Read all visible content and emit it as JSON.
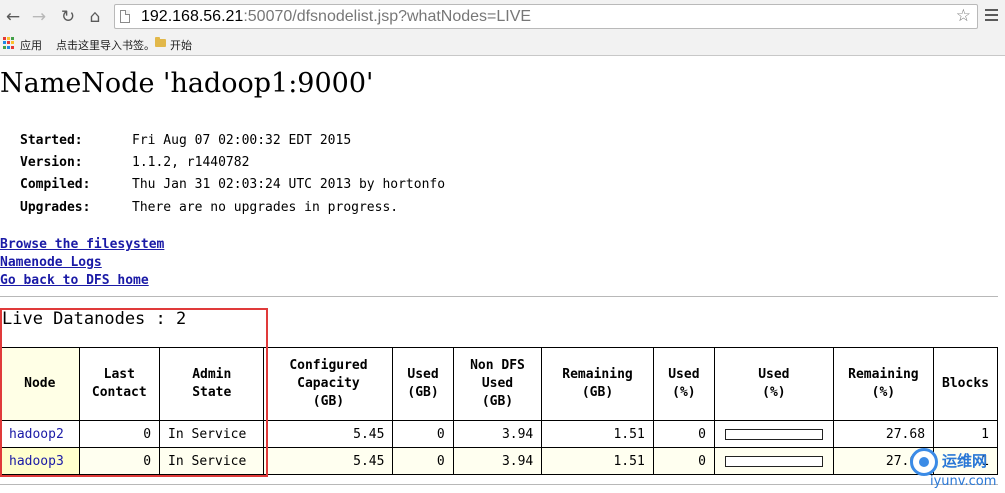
{
  "browser": {
    "url_host": "192.168.56.21",
    "url_rest": ":50070/dfsnodelist.jsp?whatNodes=LIVE",
    "bookmarks": [
      "应用",
      "点击这里导入书签。",
      "开始"
    ]
  },
  "page": {
    "title": "NameNode 'hadoop1:9000'",
    "info": [
      {
        "key": "Started:",
        "value": "Fri Aug 07 02:00:32 EDT 2015"
      },
      {
        "key": "Version:",
        "value": "1.1.2, r1440782"
      },
      {
        "key": "Compiled:",
        "value": "Thu Jan 31 02:03:24 UTC 2013 by hortonfo"
      },
      {
        "key": "Upgrades:",
        "value": "There are no upgrades in progress."
      }
    ],
    "links": [
      "Browse the filesystem",
      "Namenode Logs",
      "Go back to DFS home"
    ],
    "live_title": "Live Datanodes : 2"
  },
  "table": {
    "headers": [
      {
        "l1": "Node",
        "l2": "",
        "l3": ""
      },
      {
        "l1": "Last",
        "l2": "Contact",
        "l3": ""
      },
      {
        "l1": "Admin",
        "l2": "State",
        "l3": ""
      },
      {
        "l1": "Configured",
        "l2": "Capacity",
        "l3": "(GB)"
      },
      {
        "l1": "Used",
        "l2": "(GB)",
        "l3": ""
      },
      {
        "l1": "Non DFS",
        "l2": "Used",
        "l3": "(GB)"
      },
      {
        "l1": "Remaining",
        "l2": "(GB)",
        "l3": ""
      },
      {
        "l1": "Used",
        "l2": "(%)",
        "l3": ""
      },
      {
        "l1": "Used",
        "l2": "(%)",
        "l3": ""
      },
      {
        "l1": "Remaining",
        "l2": "(%)",
        "l3": ""
      },
      {
        "l1": "Blocks",
        "l2": "",
        "l3": ""
      }
    ],
    "rows": [
      {
        "node": "hadoop2",
        "last_contact": "0",
        "admin_state": "In Service",
        "capacity": "5.45",
        "used": "0",
        "non_dfs": "3.94",
        "remaining": "1.51",
        "used_pct": "0",
        "used_bar_fraction": 0.0,
        "remaining_pct": "27.68",
        "blocks": "1"
      },
      {
        "node": "hadoop3",
        "last_contact": "0",
        "admin_state": "In Service",
        "capacity": "5.45",
        "used": "0",
        "non_dfs": "3.94",
        "remaining": "1.51",
        "used_pct": "0",
        "used_bar_fraction": 0.0,
        "remaining_pct": "27.68",
        "blocks": "1"
      }
    ]
  },
  "watermark": {
    "title": "运维网",
    "sub": "iyunv.com"
  }
}
